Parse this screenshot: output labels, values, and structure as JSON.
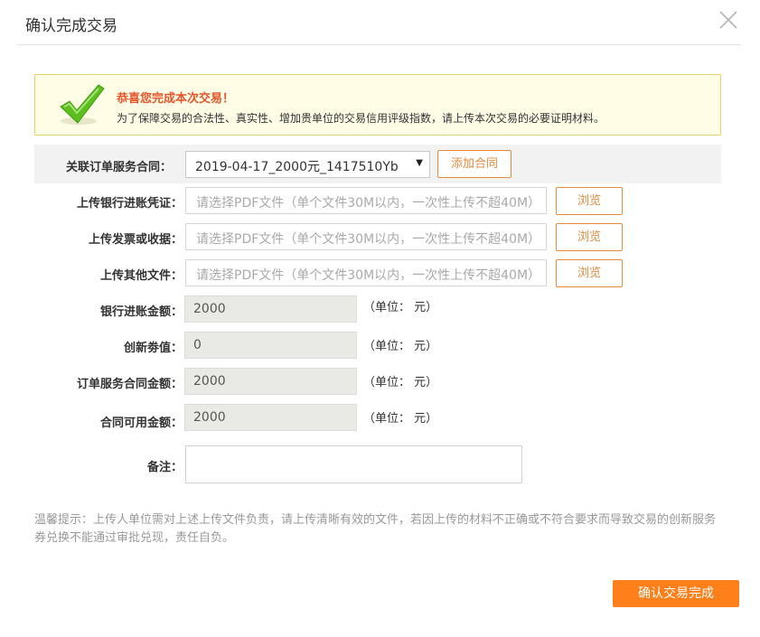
{
  "dialog": {
    "title": "确认完成交易"
  },
  "notice": {
    "title": "恭喜您完成本次交易！",
    "text": "为了保障交易的合法性、真实性、增加贵单位的交易信用评级指数，请上传本次交易的必要证明材料。"
  },
  "form": {
    "contract": {
      "label": "关联订单服务合同：",
      "selected": "2019-04-17_2000元_1417510Yb",
      "add_button": "添加合同"
    },
    "uploads": [
      {
        "label": "上传银行进账凭证：",
        "placeholder": "请选择PDF文件（单个文件30M以内，一次性上传不超40M）",
        "button": "浏览"
      },
      {
        "label": "上传发票或收据：",
        "placeholder": "请选择PDF文件（单个文件30M以内，一次性上传不超40M）",
        "button": "浏览"
      },
      {
        "label": "上传其他文件：",
        "placeholder": "请选择PDF文件（单个文件30M以内，一次性上传不超40M）",
        "button": "浏览"
      }
    ],
    "amounts": [
      {
        "label": "银行进账金额：",
        "value": "2000",
        "unit": "（单位： 元）"
      },
      {
        "label": "创新劵值：",
        "value": "0",
        "unit": "（单位： 元）"
      },
      {
        "label": "订单服务合同金额：",
        "value": "2000",
        "unit": "（单位： 元）"
      },
      {
        "label": "合同可用金额：",
        "value": "2000",
        "unit": "（单位： 元）"
      }
    ],
    "remark": {
      "label": "备注：",
      "value": ""
    }
  },
  "tip": {
    "prefix": "温馨提示：",
    "text": "上传人单位需对上述上传文件负责，请上传清晰有效的文件，若因上传的材料不正确或不符合要求而导致交易的创新服务券兑换不能通过审批兑现，责任自负。"
  },
  "footer": {
    "confirm_button": "确认交易完成"
  },
  "colors": {
    "accent": "#ff7f1a",
    "accent_outline": "#e58a3e",
    "notice_title": "#e5542a",
    "notice_bg": "#fffde6"
  }
}
